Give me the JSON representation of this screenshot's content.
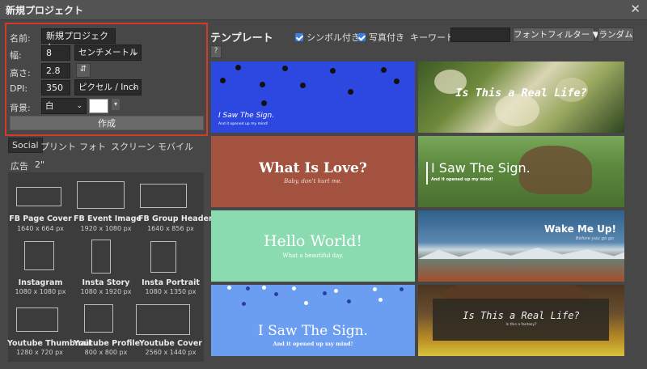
{
  "window": {
    "title": "新規プロジェクト",
    "close_glyph": "✕"
  },
  "settings": {
    "name_label": "名前:",
    "name_value": "新規プロジェクト",
    "width_label": "幅:",
    "width_value": "8",
    "width_unit": "センチメートル",
    "height_label": "高さ:",
    "height_value": "2.8",
    "swap_glyph": "⇵",
    "dpi_label": "DPI:",
    "dpi_value": "350",
    "dpi_unit": "ピクセル / Inch",
    "bg_label": "背景:",
    "bg_value": "白",
    "bg_color": "#ffffff",
    "create_label": "作成"
  },
  "preset_tabs": [
    "Social",
    "プリント",
    "フォト",
    "スクリーン",
    "モバイル",
    "広告",
    "2\""
  ],
  "presets": [
    {
      "name": "FB Page Cover",
      "dims": "1640 x 664 px"
    },
    {
      "name": "FB Event Image",
      "dims": "1920 x 1080 px"
    },
    {
      "name": "FB Group Header",
      "dims": "1640 x 856 px"
    },
    {
      "name": "Instagram",
      "dims": "1080 x 1080 px"
    },
    {
      "name": "Insta Story",
      "dims": "1080 x 1920 px"
    },
    {
      "name": "Insta Portrait",
      "dims": "1080 x 1350 px"
    },
    {
      "name": "Youtube Thumbnail",
      "dims": "1280 x 720 px"
    },
    {
      "name": "Youtube Profile",
      "dims": "800 x 800 px"
    },
    {
      "name": "Youtube Cover",
      "dims": "2560 x 1440 px"
    }
  ],
  "templates_panel": {
    "heading": "テンプレート",
    "symbol_label": "シンボル付き",
    "photo_label": "写真付き",
    "keyword_label": "キーワード:",
    "keyword_value": "",
    "font_filter_label": "フォントフィルター",
    "random_label": "ランダム",
    "help_label": "?"
  },
  "templates": [
    {
      "title": "I Saw The Sign.",
      "subtitle": "And it opened up my mind!",
      "bg": "#2c48e0"
    },
    {
      "title": "Is This a Real Life?",
      "subtitle": "",
      "bg": "#7e8a4e"
    },
    {
      "title": "What Is Love?",
      "subtitle": "Baby, don't hurt me.",
      "bg": "#a2523f"
    },
    {
      "title": "I Saw The Sign.",
      "subtitle": "And it opened up my mind!",
      "bg": "#5e7a3c"
    },
    {
      "title": "Hello World!",
      "subtitle": "What a beautiful day.",
      "bg": "#8bdbb0"
    },
    {
      "title": "Wake Me Up!",
      "subtitle": "Before you go go",
      "bg": "#3f6e95"
    },
    {
      "title": "I Saw The Sign.",
      "subtitle": "And it opened up my mind!",
      "bg": "#6b9df0"
    },
    {
      "title": "Is This a Real Life?",
      "subtitle": "Is this a fantasy?",
      "bg": "#6a4e2e"
    }
  ]
}
